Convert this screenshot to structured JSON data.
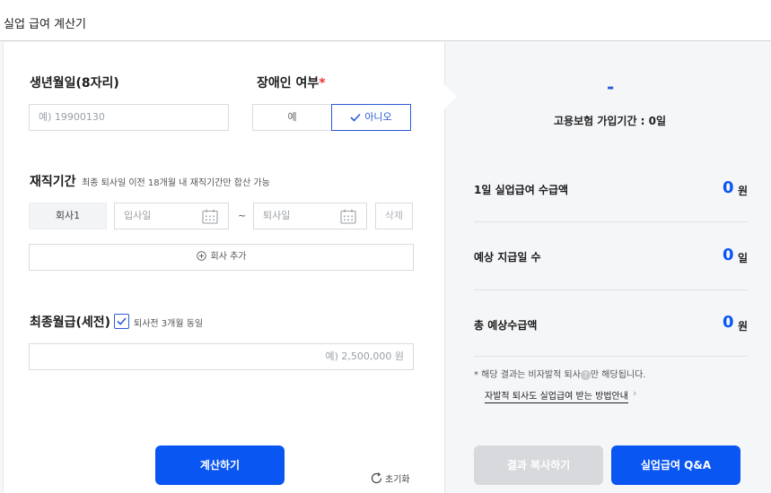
{
  "header": {
    "title": "실업 급여 계산기"
  },
  "form": {
    "birth": {
      "label": "생년월일(8자리)",
      "placeholder": "예) 19900130"
    },
    "disability": {
      "label": "장애인 여부",
      "required_mark": "*",
      "options": [
        "예",
        "아니오"
      ],
      "selected": "아니오"
    },
    "employment": {
      "label": "재직기간",
      "note": "최종 퇴사일 이전 18개월 내 재직기간만 합산 가능",
      "company_label": "회사1",
      "start_placeholder": "입사일",
      "separator": "~",
      "end_placeholder": "퇴사일",
      "delete_label": "삭제",
      "add_label": "회사 추가"
    },
    "salary": {
      "label": "최종월급(세전)",
      "checkbox_label": "퇴사전 3개월 동일",
      "checkbox_checked": true,
      "placeholder": "예) 2,500,000 원"
    },
    "calculate_label": "계산하기",
    "reset_label": "초기화"
  },
  "result": {
    "summary_value": "-",
    "insured_period": "고용보험 가입기간 : 0일",
    "rows": [
      {
        "label": "1일 실업급여 수급액",
        "value": "0",
        "unit": "원"
      },
      {
        "label": "예상 지급일 수",
        "value": "0",
        "unit": "일"
      },
      {
        "label": "총 예상수급액",
        "value": "0",
        "unit": "원"
      }
    ],
    "notice_prefix": "* 해당 결과는 비자발적 퇴사",
    "notice_suffix": "만 해당됩니다.",
    "notice_help": "?",
    "guide_link": "자발적 퇴사도 실업급여 받는 방법안내",
    "guide_chevron": "›",
    "copy_label": "결과 복사하기",
    "qa_label": "실업급여 Q&A"
  },
  "colors": {
    "accent": "#0a56f2",
    "required": "#e53935",
    "disabled": "#d7d9dd"
  }
}
